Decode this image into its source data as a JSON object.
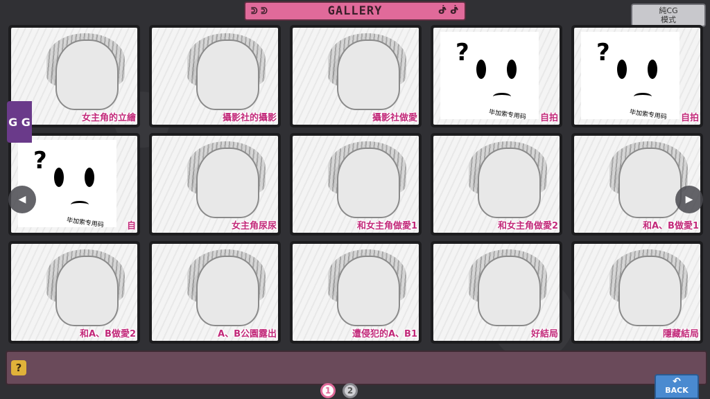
{
  "header": {
    "title": "GALLERY",
    "left_ornament": "ᕲ ᕲ",
    "right_ornament": "ᕸ ᕸ"
  },
  "mode_button": {
    "line1": "純CG",
    "line2": "模式"
  },
  "side_tab": {
    "label": "G G"
  },
  "nav": {
    "left_icon": "left-arrow-icon",
    "right_icon": "right-arrow-icon",
    "left_glyph": "◀",
    "right_glyph": "▶"
  },
  "gallery": {
    "items": [
      {
        "caption": "女主角的立繪",
        "placeholder": false
      },
      {
        "caption": "攝影社的攝影",
        "placeholder": false
      },
      {
        "caption": "攝影社做愛",
        "placeholder": false
      },
      {
        "caption": "自拍",
        "placeholder": true
      },
      {
        "caption": "自拍",
        "placeholder": true
      },
      {
        "caption": "自",
        "placeholder": true
      },
      {
        "caption": "女主角尿尿",
        "placeholder": false
      },
      {
        "caption": "和女主角做愛1",
        "placeholder": false
      },
      {
        "caption": "和女主角做愛2",
        "placeholder": false
      },
      {
        "caption": "和A、B做愛1",
        "placeholder": false
      },
      {
        "caption": "和A、B做愛2",
        "placeholder": false
      },
      {
        "caption": "A、B公園露出",
        "placeholder": false
      },
      {
        "caption": "遭侵犯的A、B1",
        "placeholder": false
      },
      {
        "caption": "好結局",
        "placeholder": false
      },
      {
        "caption": "隱藏結局",
        "placeholder": false
      }
    ],
    "placeholder_text": {
      "qmark": "?",
      "watermark": "毕加索专用码"
    }
  },
  "description_bar": {
    "help_icon": "?"
  },
  "pager": {
    "pages": [
      "1",
      "2"
    ],
    "current": "1"
  },
  "back_button": {
    "label": "BACK",
    "icon": "undo-arrow-icon",
    "glyph": "↶"
  },
  "colors": {
    "accent": "#e06a9a",
    "caption": "#c22a7a",
    "panel": "#6a4a5a",
    "back": "#4a8ad0"
  }
}
